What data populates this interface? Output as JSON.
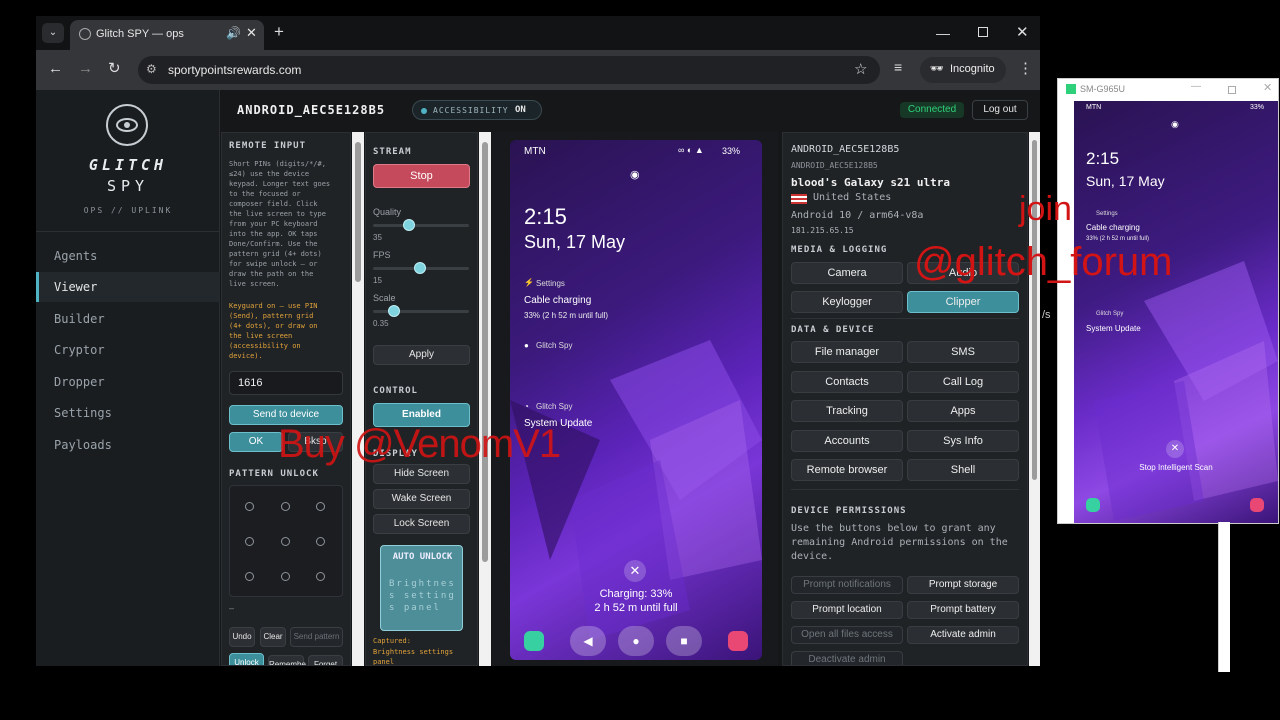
{
  "browser": {
    "tab_title": "Glitch SPY — ops",
    "url": "sportypointsrewards.com",
    "incognito": "Incognito"
  },
  "header": {
    "device_id": "ANDROID_AEC5E128B5",
    "accessibility_label": "ACCESSIBILITY",
    "accessibility_state": "ON",
    "connected": "Connected",
    "logout": "Log out"
  },
  "brand": {
    "line1": "GLITCH",
    "line2": "SPY",
    "tagline": "OPS // UPLINK"
  },
  "sidebar": {
    "items": [
      {
        "label": "Agents"
      },
      {
        "label": "Viewer"
      },
      {
        "label": "Builder"
      },
      {
        "label": "Cryptor"
      },
      {
        "label": "Dropper"
      },
      {
        "label": "Settings"
      },
      {
        "label": "Payloads"
      }
    ]
  },
  "remote_input": {
    "title": "REMOTE INPUT",
    "help_lines": [
      "Short PINs (digits/*/#,",
      "≤24) use the device",
      "keypad. Longer text goes",
      "to the focused or",
      "composer field. Click",
      "the live screen to type",
      "from your PC keyboard",
      "into the app. OK taps",
      "Done/Confirm. Use the",
      "pattern grid (4+ dots)",
      "for swipe unlock — or",
      "draw the path on the",
      "live screen."
    ],
    "note_lines": [
      "Keyguard on — use PIN",
      "(Send), pattern grid",
      "(4+ dots), or draw on",
      "the live screen",
      "(accessibility on",
      "device)."
    ],
    "input_value": "1616",
    "send": "Send to device",
    "ok": "OK",
    "bksp": "Bksp",
    "pattern_title": "PATTERN UNLOCK",
    "dash": "–",
    "undo": "Undo",
    "clear": "Clear",
    "send_pattern": "Send pattern",
    "unlock": "Unlock",
    "remember": "Remembe",
    "forget": "Forget"
  },
  "stream": {
    "title": "STREAM",
    "stop": "Stop",
    "quality_label": "Quality",
    "quality_value": "35",
    "fps_label": "FPS",
    "fps_value": "15",
    "scale_label": "Scale",
    "scale_value": "0.35",
    "apply": "Apply",
    "control_title": "CONTROL",
    "enabled": "Enabled",
    "display_title": "DISPLAY",
    "hide": "Hide Screen",
    "wake": "Wake Screen",
    "lock": "Lock Screen",
    "auto_unlock": "AUTO UNLOCK",
    "auto_text": "Brightness settings panel",
    "captured": "Captured:",
    "captured_text": "Brightness settings panel"
  },
  "phone": {
    "carrier": "MTN",
    "battery": "33%",
    "time": "2:15",
    "date": "Sun, 17 May",
    "notif1_app": "Settings",
    "notif1_title": "Cable charging",
    "notif1_body": "33% (2 h 52 m until full)",
    "notif2_app": "Glitch Spy",
    "notif3_app": "Glitch Spy",
    "notif3_title": "System Update",
    "charging": "Charging: 33%",
    "until_full": "2 h 52 m until full"
  },
  "device": {
    "id": "ANDROID_AEC5E128B5",
    "id_small": "ANDROID_AEC5E128B5",
    "name": "blood's Galaxy s21 ultra",
    "country": "United States",
    "os": "Android 10 / arm64-v8a",
    "ip": "181.215.65.15",
    "media_title": "MEDIA & LOGGING",
    "camera": "Camera",
    "audio": "Audio",
    "keylogger": "Keylogger",
    "clipper": "Clipper",
    "data_title": "DATA & DEVICE",
    "file_manager": "File manager",
    "sms": "SMS",
    "contacts": "Contacts",
    "call_log": "Call Log",
    "tracking": "Tracking",
    "apps": "Apps",
    "accounts": "Accounts",
    "sys_info": "Sys Info",
    "remote_browser": "Remote browser",
    "shell": "Shell",
    "perm_title": "DEVICE PERMISSIONS",
    "perm_desc": [
      "Use the buttons below to grant any",
      "remaining Android permissions on the",
      "device."
    ],
    "prompt_notifications": "Prompt notifications",
    "prompt_storage": "Prompt storage",
    "prompt_location": "Prompt location",
    "prompt_battery": "Prompt battery",
    "open_files": "Open all files access",
    "activate_admin": "Activate admin",
    "deactivate_admin": "Deactivate admin"
  },
  "mirror": {
    "title": "SM-G965U",
    "carrier": "MTN",
    "battery": "33%",
    "time": "2:15",
    "date": "Sun, 17 May",
    "n1_app": "Settings",
    "n1_title": "Cable charging",
    "n1_body": "33% (2 h 52 m until full)",
    "n2_app": "Glitch Spy",
    "n2_title": "System Update",
    "stop_scan": "Stop Intelligent Scan",
    "peek": "/s"
  },
  "watermarks": {
    "buy": "Buy @VenomV1",
    "join": "join",
    "forum": "@glitch_forum"
  },
  "colors": {
    "accent": "#4fb3c4",
    "connected": "#2fd07a",
    "danger": "#c44a5c"
  }
}
